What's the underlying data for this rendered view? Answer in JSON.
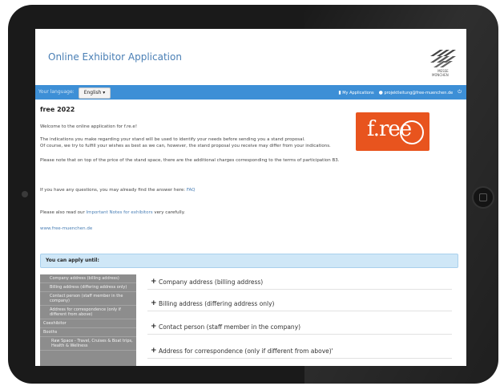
{
  "app": {
    "title": "Online Exhibitor Application",
    "logo_text": "MESSE\nMÜNCHEN"
  },
  "toolbar": {
    "language_label": "Your language:",
    "language_value": "English ▾",
    "my_applications": "My Applications",
    "user_email": "projektleitung@free-muenchen.de"
  },
  "page": {
    "title": "free 2022",
    "welcome": "Welcome to the online application for f.re.e!",
    "indications_1": "The indications you make regarding your stand will be used to identify your needs before sending you a stand proposal.",
    "indications_2": "Of course, we try to fulfill your wishes as best as we can, however, the stand proposal you receive may differ from your indications.",
    "note": "Please note that on top of the price of the stand space, there are the additional charges corresponding to the terms of participation B3.",
    "faq_text": "If you have any questions, you may already find the answer here: ",
    "faq_link": "FAQ",
    "notes_prefix": "Please also read our ",
    "notes_link": "Important Notes for exhibitors",
    "notes_suffix": " very carefully.",
    "website_link": "www.free-muenchen.de",
    "apply_until": "You can apply until:"
  },
  "fair_logo": {
    "text": "f.ree"
  },
  "sidebar": {
    "items": [
      {
        "label": "Company address (billing address)"
      },
      {
        "label": "Billing address (differing address only)"
      },
      {
        "label": "Contact person (staff member in the company)"
      },
      {
        "label": "Address for correspondence (only if different from above)"
      },
      {
        "label": "Coexhibitor"
      },
      {
        "label": "Booths"
      },
      {
        "label": "Raw Space - Travel, Cruises & Boat trips, Health & Wellness"
      }
    ]
  },
  "sections": [
    {
      "label": "Company address (billing address)"
    },
    {
      "label": "Billing address (differing address only)"
    },
    {
      "label": "Contact person (staff member in the company)"
    },
    {
      "label": "Address for correspondence (only if different from above)'"
    }
  ],
  "colors": {
    "accent": "#3d8fd6",
    "title_blue": "#4a7fb5",
    "free_orange": "#e8541e",
    "apply_bg": "#cfe7f7",
    "sidebar_bg": "#8d8d8d"
  }
}
